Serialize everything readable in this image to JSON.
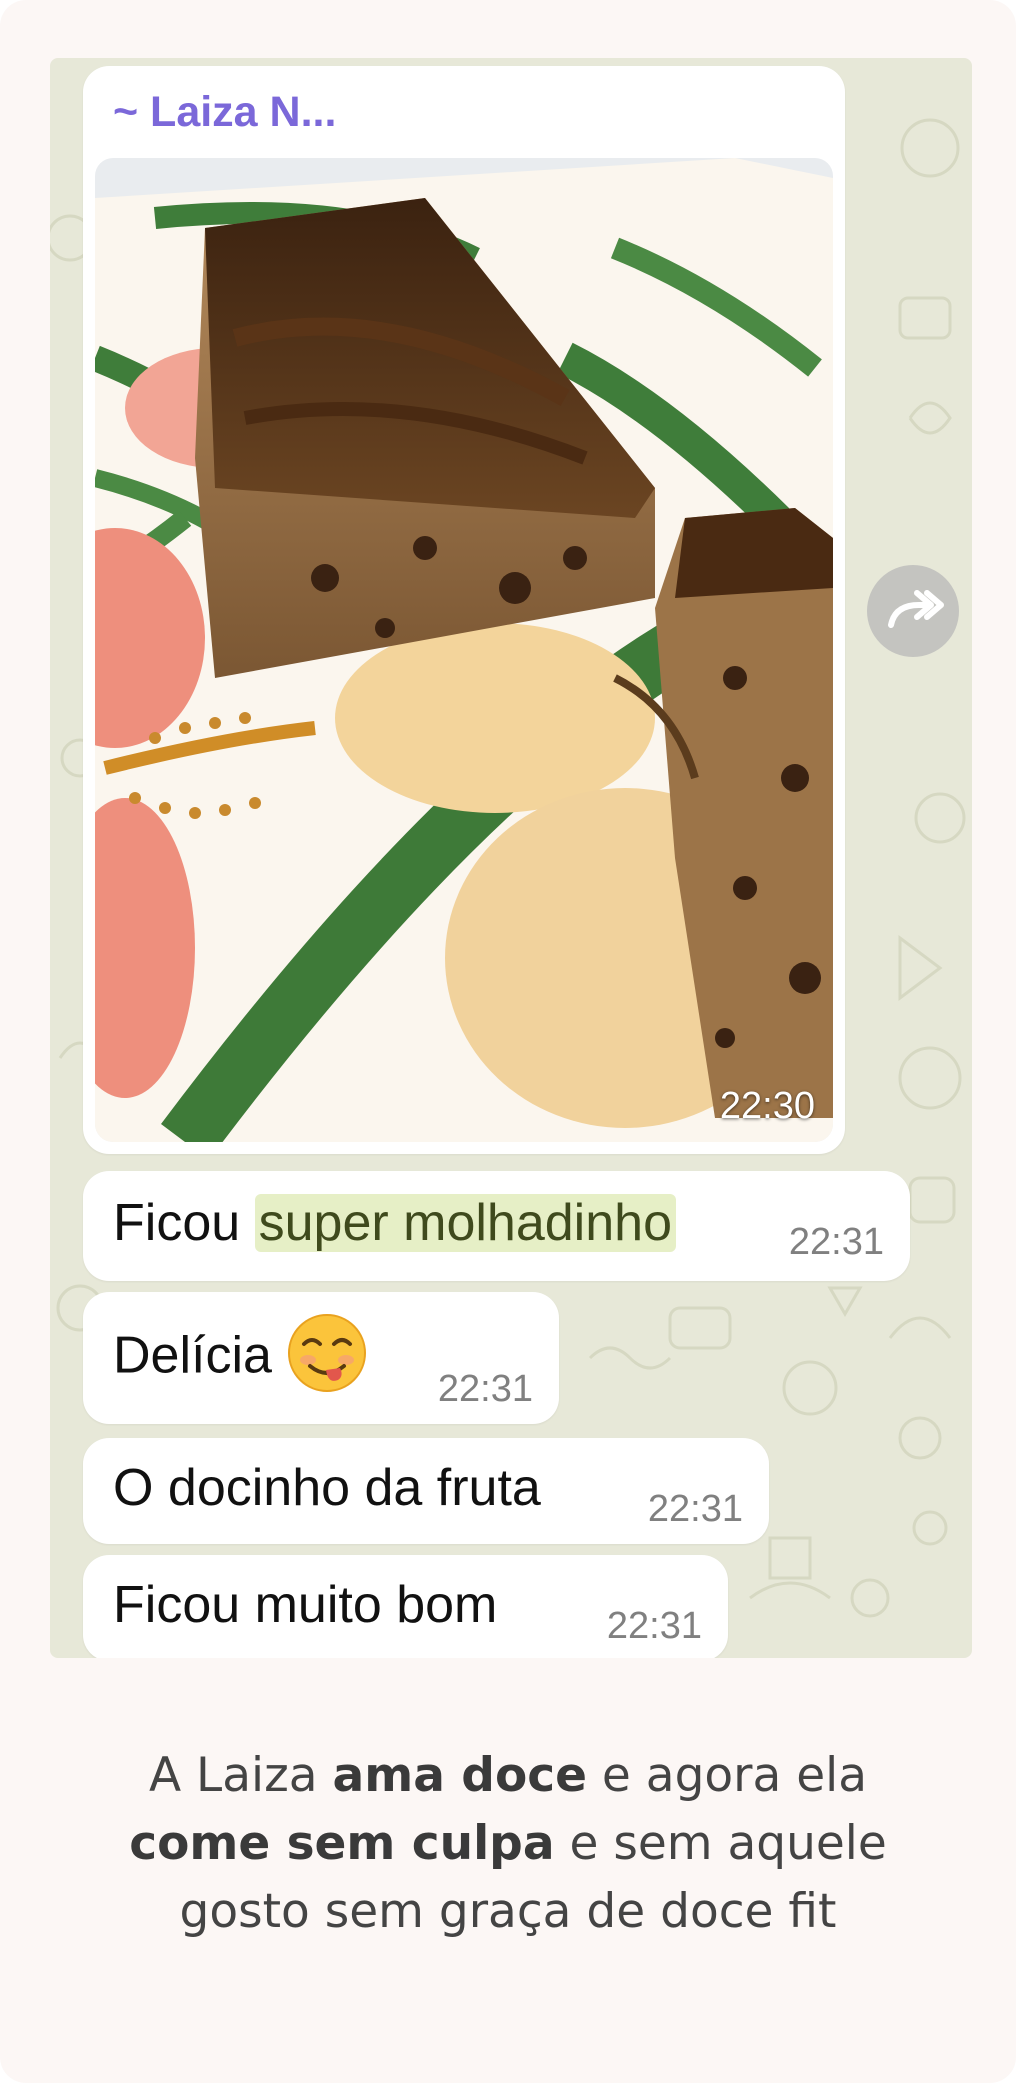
{
  "sender": "~ Laiza N...",
  "photo": {
    "time": "22:30",
    "alt": "Pedaço de bolo de banana com chocolate em prato decorado"
  },
  "messages": [
    {
      "before": "Ficou ",
      "highlight": "super molhadinho",
      "after": "",
      "time": "22:31"
    },
    {
      "text": "Delícia",
      "emoji": "smiling-face-with-tongue-icon",
      "time": "22:31"
    },
    {
      "text": "O docinho da fruta",
      "time": "22:31"
    },
    {
      "text": "Ficou muito bom",
      "time": "22:31"
    }
  ],
  "caption": {
    "line1_a": "A Laiza ",
    "line1_bold": "ama doce",
    "line1_b": " e agora ela",
    "line2_bold": "come sem culpa",
    "line2_a": " e sem aquele",
    "line3": "gosto sem graça de doce fit"
  },
  "colors": {
    "chat_background": "#e7e8d8",
    "sender_name": "#7b68d9",
    "highlight": "#e6efc6",
    "page_background": "#fcf7f5"
  }
}
